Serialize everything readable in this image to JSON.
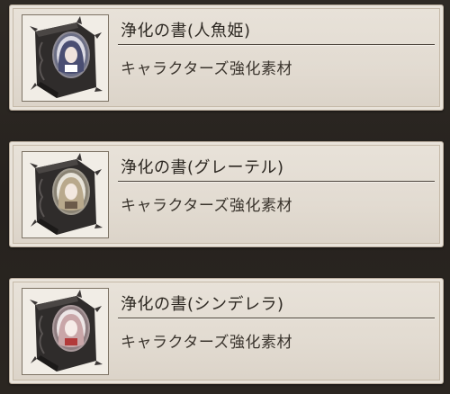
{
  "items": [
    {
      "title": "浄化の書(人魚姫)",
      "description": "キャラクターズ強化素材",
      "icon": "purification-book-icon",
      "portrait_hair_color": "#4a4e72",
      "portrait_frame_color": "#6c6f86"
    },
    {
      "title": "浄化の書(グレーテル)",
      "description": "キャラクターズ強化素材",
      "icon": "purification-book-icon",
      "portrait_hair_color": "#b9a98c",
      "portrait_frame_color": "#8a8374"
    },
    {
      "title": "浄化の書(シンデレラ)",
      "description": "キャラクターズ強化素材",
      "icon": "purification-book-icon",
      "portrait_hair_color": "#c9a6a8",
      "portrait_frame_color": "#8f7d80"
    }
  ]
}
